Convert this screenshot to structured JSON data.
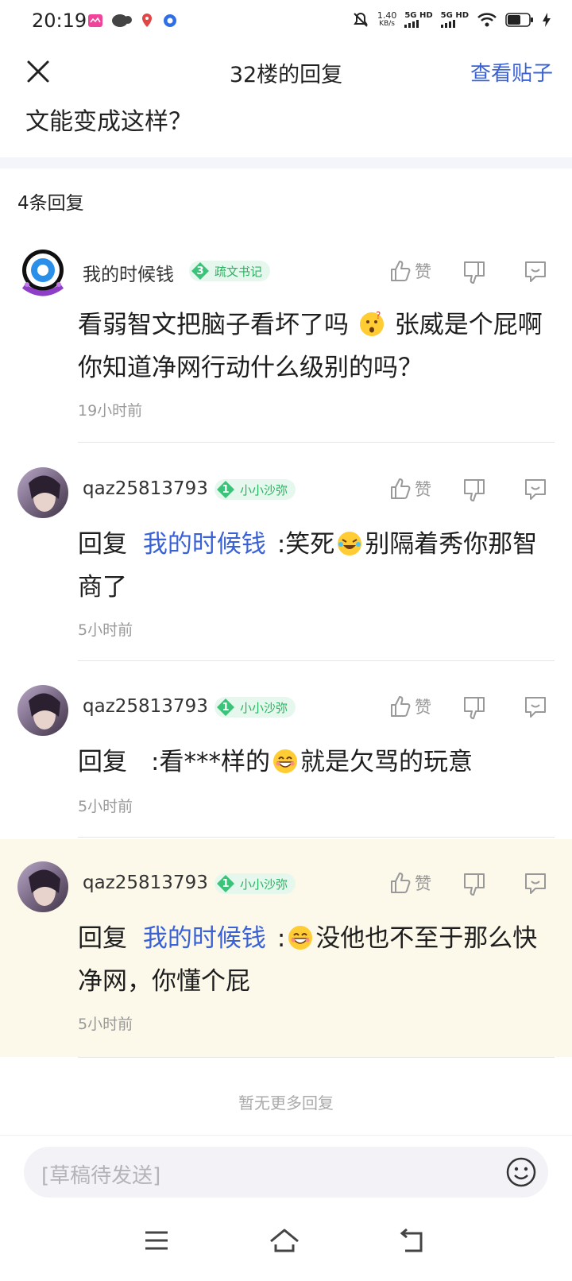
{
  "status_bar": {
    "time": "20:19",
    "net_speed_value": "1.40",
    "net_speed_unit": "KB/s",
    "sim1": "5G HD",
    "sim2": "5G HD"
  },
  "header": {
    "title": "32楼的回复",
    "view_post_label": "查看贴子"
  },
  "post_excerpt": "文能变成这样？",
  "reply_count_label": "4条回复",
  "like_label": "赞",
  "replies": [
    {
      "username": "我的时候钱",
      "level": "3",
      "title": "疏文书记",
      "content_a": "看弱智文把脑子看坏了吗",
      "content_b": "张威是个屁啊你知道净网行动什么级别的吗？",
      "time": "19小时前"
    },
    {
      "username": "qaz25813793",
      "level": "1",
      "title": "小小沙弥",
      "reply_prefix": "回复",
      "mention": "我的时候钱",
      "content_a": ":笑死",
      "content_b": "别隔着秀你那智商了",
      "time": "5小时前"
    },
    {
      "username": "qaz25813793",
      "level": "1",
      "title": "小小沙弥",
      "reply_prefix": "回复",
      "content_a": ":看***样的",
      "content_b": "就是欠骂的玩意",
      "time": "5小时前"
    },
    {
      "username": "qaz25813793",
      "level": "1",
      "title": "小小沙弥",
      "reply_prefix": "回复",
      "mention": "我的时候钱",
      "content_a": ":",
      "content_b": "没他也不至于那么快净网，你懂个屁",
      "time": "5小时前"
    }
  ],
  "no_more_label": "暂无更多回复",
  "input": {
    "placeholder": "[草稿待发送]"
  },
  "colors": {
    "accent": "#3a62d6",
    "badge_green": "#27b35f",
    "highlight_bg": "#fcf8ea"
  }
}
